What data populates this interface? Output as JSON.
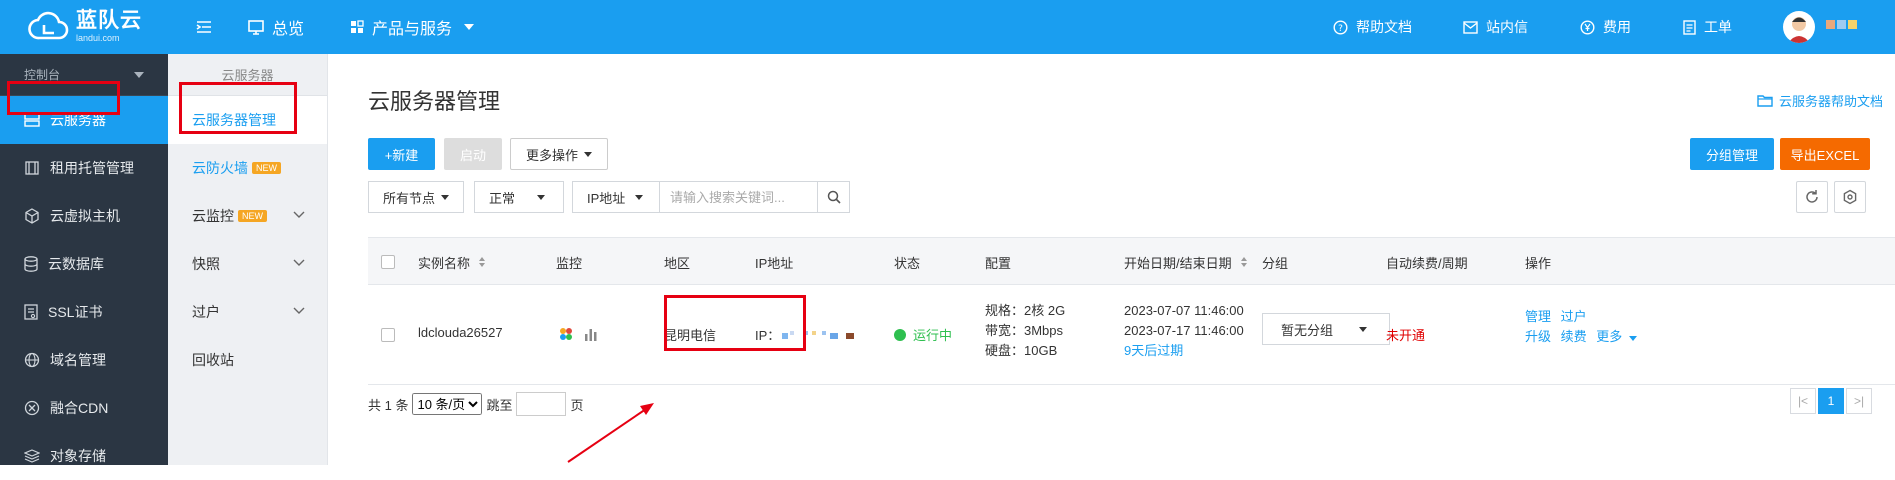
{
  "brand": {
    "name": "蓝队云",
    "domain": "landui.com"
  },
  "topnav": {
    "home": "总览",
    "products": "产品与服务"
  },
  "topright": {
    "help": "帮助文档",
    "messages": "站内信",
    "fees": "费用",
    "tickets": "工单"
  },
  "sidebar": {
    "head": "控制台",
    "items": [
      {
        "label": "云服务器",
        "icon": "server-icon"
      },
      {
        "label": "租用托管管理",
        "icon": "rack-icon"
      },
      {
        "label": "云虚拟主机",
        "icon": "cube-icon"
      },
      {
        "label": "云数据库",
        "icon": "database-icon"
      },
      {
        "label": "SSL证书",
        "icon": "certificate-icon"
      },
      {
        "label": "域名管理",
        "icon": "globe-icon"
      },
      {
        "label": "融合CDN",
        "icon": "cdn-icon"
      },
      {
        "label": "对象存储",
        "icon": "storage-icon"
      }
    ]
  },
  "subsidebar": {
    "head": "云服务器",
    "items": [
      "云服务器管理",
      "云防火墙",
      "云监控",
      "快照",
      "过户",
      "回收站"
    ],
    "new_badge": "NEW"
  },
  "main": {
    "title": "云服务器管理",
    "help_link": "云服务器帮助文档",
    "buttons": {
      "new": "+新建",
      "start": "启动",
      "more_ops": "更多操作",
      "group_manage": "分组管理",
      "export": "导出EXCEL"
    },
    "filters": {
      "node": "所有节点",
      "status": "正常",
      "field": "IP地址",
      "search_placeholder": "请输入搜索关键词..."
    }
  },
  "table": {
    "headers": [
      "实例名称",
      "监控",
      "地区",
      "IP地址",
      "状态",
      "配置",
      "开始日期/结束日期",
      "分组",
      "自动续费/周期",
      "操作"
    ],
    "row": {
      "name": "ldclouda26527",
      "region": "昆明电信",
      "ip_label": "IP：",
      "status": "运行中",
      "spec": "规格：2核 2G",
      "bandwidth": "带宽：3Mbps",
      "disk": "硬盘：10GB",
      "start": "2023-07-07 11:46:00",
      "end": "2023-07-17 11:46:00",
      "expire": "9天后过期",
      "group": "暂无分组",
      "renew": "未开通",
      "ops": [
        "管理",
        "过户",
        "升级",
        "续费",
        "更多"
      ]
    }
  },
  "pager": {
    "total_prefix": "共 1 条",
    "page_size": "10 条/页",
    "goto": "跳至",
    "page_unit": "页",
    "current": "1"
  },
  "colors": {
    "primary": "#1a9ef0",
    "sidebar": "#2b3643",
    "orange": "#f56a00",
    "success": "#2ebf4f",
    "danger": "#e00000",
    "highlight": "#e60012"
  }
}
